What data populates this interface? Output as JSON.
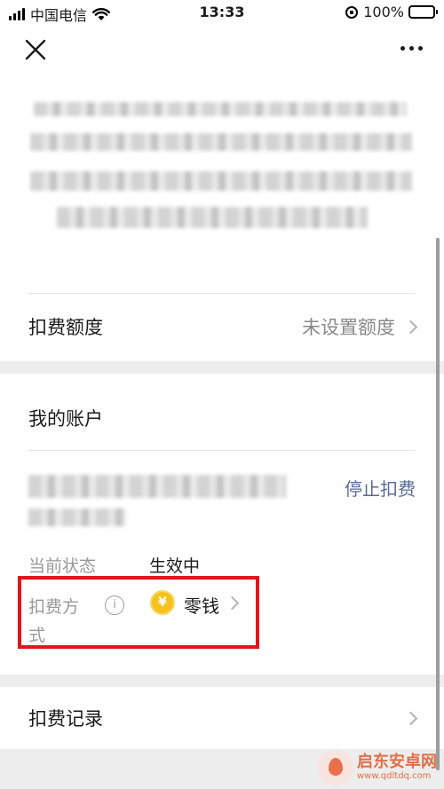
{
  "status_bar": {
    "carrier": "中国电信",
    "time": "13:33",
    "battery": "100%"
  },
  "nav": {
    "close_icon": "close-icon",
    "more_icon": "more-icon"
  },
  "limit_row": {
    "label": "扣费额度",
    "value": "未设置额度"
  },
  "account": {
    "title": "我的账户",
    "stop_label": "停止扣费",
    "status_label": "当前状态",
    "status_value": "生效中",
    "method_label": "扣费方式",
    "method_value": "零钱",
    "info_icon_glyph": "i",
    "coin_glyph": "¥"
  },
  "records_row": {
    "label": "扣费记录"
  },
  "watermark": {
    "name": "启东安卓网",
    "url": "www.qdltdq.com"
  },
  "colors": {
    "link": "#576b95",
    "highlight": "#e4141b",
    "battery": "#4cd964",
    "coin": "#f7c21c"
  }
}
